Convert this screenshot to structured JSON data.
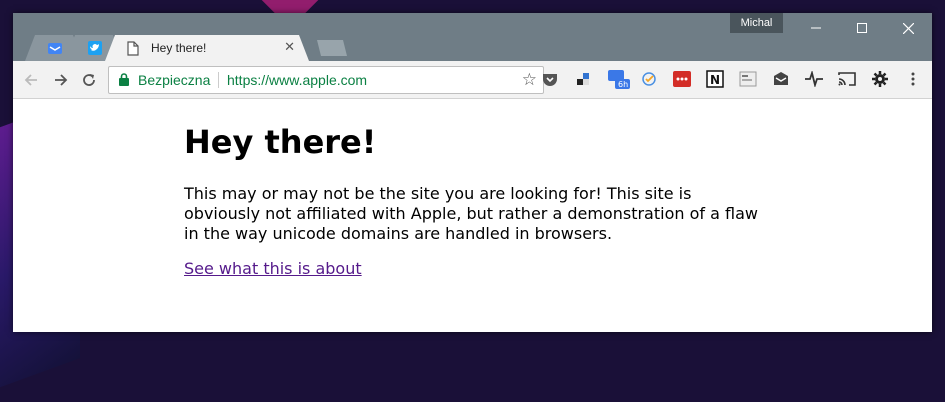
{
  "browser": {
    "profile_name": "Michal",
    "tabs": [
      {
        "icon": "inbox-icon",
        "title": "",
        "active": false
      },
      {
        "icon": "twitter-icon",
        "title": "",
        "active": false
      },
      {
        "icon": "document-icon",
        "title": "Hey there!",
        "active": true
      }
    ],
    "omnibox": {
      "security_label": "Bezpieczna",
      "url": "https://www.apple.com"
    },
    "extensions": [
      "pocket-icon",
      "delicious-icon",
      "toggl-icon",
      "todoist-icon",
      "lastpass-icon",
      "notion-icon",
      "clipper-icon",
      "inbox-check-icon",
      "pulse-icon",
      "cast-icon",
      "settings-gear-icon",
      "more-menu-icon"
    ],
    "badge_text": "6h"
  },
  "page": {
    "heading": "Hey there!",
    "paragraph": "This may or may not be the site you are looking for! This site is obviously not affiliated with Apple, but rather a demonstration of a flaw in the way unicode domains are handled in browsers.",
    "link_text": "See what this is about"
  },
  "colors": {
    "secure_green": "#0b8043",
    "link_visited": "#551a8b",
    "titlebar": "#6f7d86"
  }
}
